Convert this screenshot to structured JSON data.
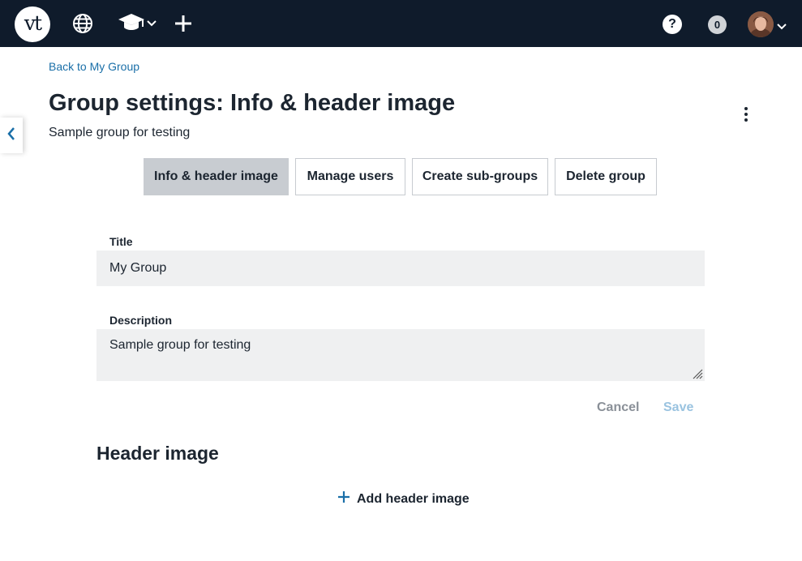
{
  "topbar": {
    "logo_text": "vt",
    "help_label": "?",
    "notifications_count": "0",
    "colors": {
      "background": "#0f1b2b"
    }
  },
  "nav": {
    "back_link": "Back to My Group"
  },
  "page": {
    "title": "Group settings: Info & header image",
    "subtitle": "Sample group for testing"
  },
  "tabs": [
    {
      "label": "Info & header image",
      "active": true
    },
    {
      "label": "Manage users",
      "active": false
    },
    {
      "label": "Create sub-groups",
      "active": false
    },
    {
      "label": "Delete group",
      "active": false
    }
  ],
  "form": {
    "title_label": "Title",
    "title_value": "My Group",
    "description_label": "Description",
    "description_value": "Sample group for testing",
    "cancel_label": "Cancel",
    "save_label": "Save"
  },
  "header_image": {
    "section_title": "Header image",
    "add_label": "Add header image"
  },
  "colors": {
    "accent": "#1a6fa8",
    "tab_active_bg": "#c8ccd1",
    "field_bg": "#eff0f1",
    "save_disabled": "#9ac3e0"
  }
}
